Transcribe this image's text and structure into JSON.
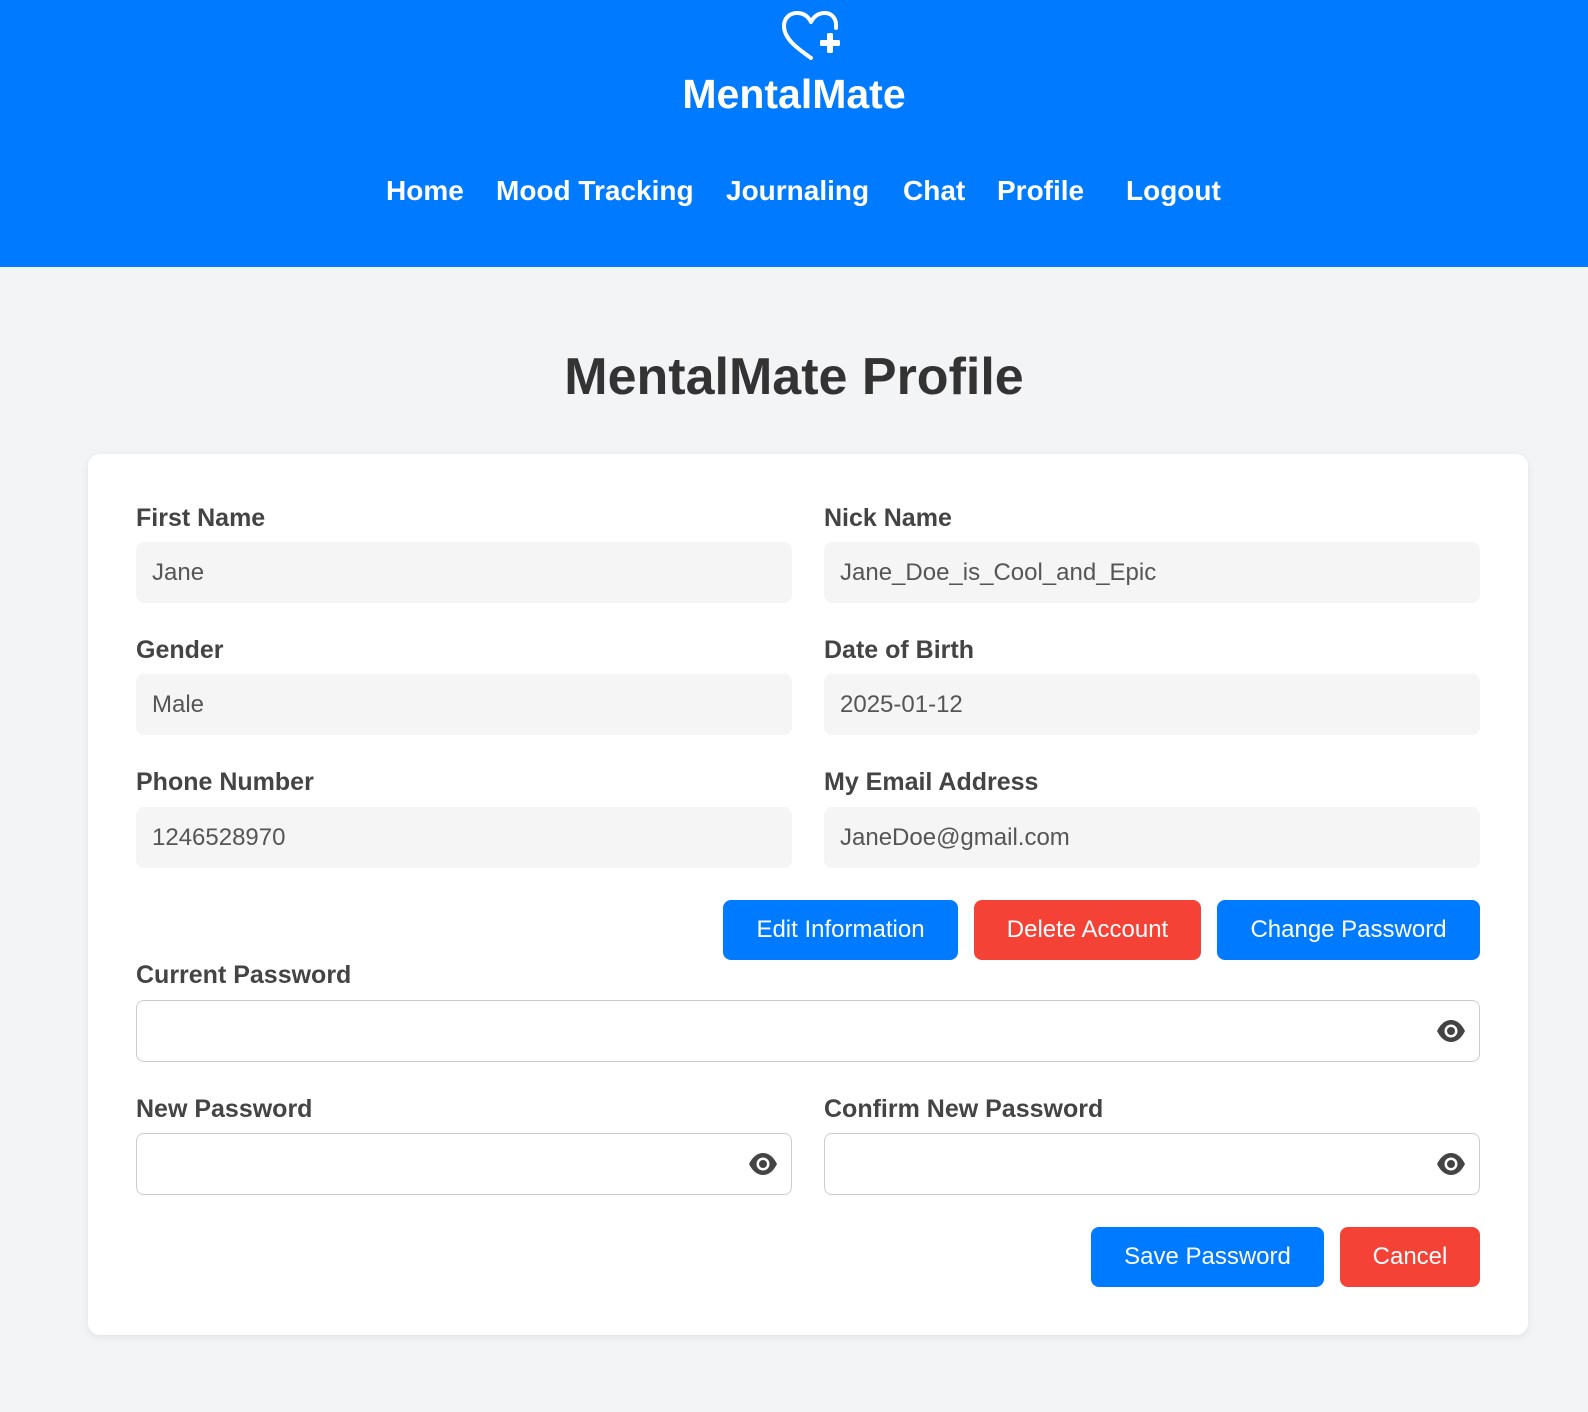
{
  "header": {
    "brand": "MentalMate",
    "logo_icon": "heart-plus-icon",
    "nav": [
      "Home",
      "Mood Tracking",
      "Journaling",
      "Chat",
      "Profile",
      "Logout"
    ]
  },
  "page": {
    "title": "MentalMate Profile"
  },
  "profile": {
    "first_name": {
      "label": "First Name",
      "value": "Jane"
    },
    "nick_name": {
      "label": "Nick Name",
      "value": "Jane_Doe_is_Cool_and_Epic"
    },
    "gender": {
      "label": "Gender",
      "value": "Male"
    },
    "dob": {
      "label": "Date of Birth",
      "value": "2025-01-12"
    },
    "phone": {
      "label": "Phone Number",
      "value": "1246528970"
    },
    "email": {
      "label": "My Email Address",
      "value": "JaneDoe@gmail.com"
    }
  },
  "actions": {
    "edit": "Edit Information",
    "delete": "Delete Account",
    "change_password": "Change Password"
  },
  "password": {
    "current_label": "Current Password",
    "new_label": "New Password",
    "confirm_label": "Confirm New Password",
    "toggle_icon": "eye-icon",
    "save": "Save Password",
    "cancel": "Cancel"
  },
  "colors": {
    "primary": "#007bff",
    "danger": "#f44336",
    "background": "#f3f4f6"
  }
}
